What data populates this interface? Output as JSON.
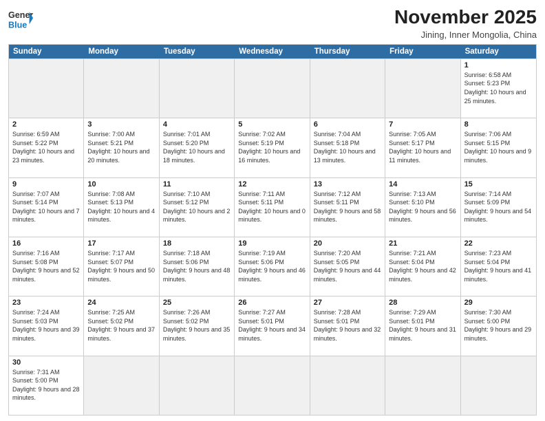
{
  "logo": {
    "text_general": "General",
    "text_blue": "Blue"
  },
  "title": "November 2025",
  "location": "Jining, Inner Mongolia, China",
  "header_days": [
    "Sunday",
    "Monday",
    "Tuesday",
    "Wednesday",
    "Thursday",
    "Friday",
    "Saturday"
  ],
  "rows": [
    [
      {
        "day": "",
        "info": "",
        "empty": true
      },
      {
        "day": "",
        "info": "",
        "empty": true
      },
      {
        "day": "",
        "info": "",
        "empty": true
      },
      {
        "day": "",
        "info": "",
        "empty": true
      },
      {
        "day": "",
        "info": "",
        "empty": true
      },
      {
        "day": "",
        "info": "",
        "empty": true
      },
      {
        "day": "1",
        "info": "Sunrise: 6:58 AM\nSunset: 5:23 PM\nDaylight: 10 hours\nand 25 minutes.",
        "empty": false
      }
    ],
    [
      {
        "day": "2",
        "info": "Sunrise: 6:59 AM\nSunset: 5:22 PM\nDaylight: 10 hours\nand 23 minutes.",
        "empty": false
      },
      {
        "day": "3",
        "info": "Sunrise: 7:00 AM\nSunset: 5:21 PM\nDaylight: 10 hours\nand 20 minutes.",
        "empty": false
      },
      {
        "day": "4",
        "info": "Sunrise: 7:01 AM\nSunset: 5:20 PM\nDaylight: 10 hours\nand 18 minutes.",
        "empty": false
      },
      {
        "day": "5",
        "info": "Sunrise: 7:02 AM\nSunset: 5:19 PM\nDaylight: 10 hours\nand 16 minutes.",
        "empty": false
      },
      {
        "day": "6",
        "info": "Sunrise: 7:04 AM\nSunset: 5:18 PM\nDaylight: 10 hours\nand 13 minutes.",
        "empty": false
      },
      {
        "day": "7",
        "info": "Sunrise: 7:05 AM\nSunset: 5:17 PM\nDaylight: 10 hours\nand 11 minutes.",
        "empty": false
      },
      {
        "day": "8",
        "info": "Sunrise: 7:06 AM\nSunset: 5:15 PM\nDaylight: 10 hours\nand 9 minutes.",
        "empty": false
      }
    ],
    [
      {
        "day": "9",
        "info": "Sunrise: 7:07 AM\nSunset: 5:14 PM\nDaylight: 10 hours\nand 7 minutes.",
        "empty": false
      },
      {
        "day": "10",
        "info": "Sunrise: 7:08 AM\nSunset: 5:13 PM\nDaylight: 10 hours\nand 4 minutes.",
        "empty": false
      },
      {
        "day": "11",
        "info": "Sunrise: 7:10 AM\nSunset: 5:12 PM\nDaylight: 10 hours\nand 2 minutes.",
        "empty": false
      },
      {
        "day": "12",
        "info": "Sunrise: 7:11 AM\nSunset: 5:11 PM\nDaylight: 10 hours\nand 0 minutes.",
        "empty": false
      },
      {
        "day": "13",
        "info": "Sunrise: 7:12 AM\nSunset: 5:11 PM\nDaylight: 9 hours\nand 58 minutes.",
        "empty": false
      },
      {
        "day": "14",
        "info": "Sunrise: 7:13 AM\nSunset: 5:10 PM\nDaylight: 9 hours\nand 56 minutes.",
        "empty": false
      },
      {
        "day": "15",
        "info": "Sunrise: 7:14 AM\nSunset: 5:09 PM\nDaylight: 9 hours\nand 54 minutes.",
        "empty": false
      }
    ],
    [
      {
        "day": "16",
        "info": "Sunrise: 7:16 AM\nSunset: 5:08 PM\nDaylight: 9 hours\nand 52 minutes.",
        "empty": false
      },
      {
        "day": "17",
        "info": "Sunrise: 7:17 AM\nSunset: 5:07 PM\nDaylight: 9 hours\nand 50 minutes.",
        "empty": false
      },
      {
        "day": "18",
        "info": "Sunrise: 7:18 AM\nSunset: 5:06 PM\nDaylight: 9 hours\nand 48 minutes.",
        "empty": false
      },
      {
        "day": "19",
        "info": "Sunrise: 7:19 AM\nSunset: 5:06 PM\nDaylight: 9 hours\nand 46 minutes.",
        "empty": false
      },
      {
        "day": "20",
        "info": "Sunrise: 7:20 AM\nSunset: 5:05 PM\nDaylight: 9 hours\nand 44 minutes.",
        "empty": false
      },
      {
        "day": "21",
        "info": "Sunrise: 7:21 AM\nSunset: 5:04 PM\nDaylight: 9 hours\nand 42 minutes.",
        "empty": false
      },
      {
        "day": "22",
        "info": "Sunrise: 7:23 AM\nSunset: 5:04 PM\nDaylight: 9 hours\nand 41 minutes.",
        "empty": false
      }
    ],
    [
      {
        "day": "23",
        "info": "Sunrise: 7:24 AM\nSunset: 5:03 PM\nDaylight: 9 hours\nand 39 minutes.",
        "empty": false
      },
      {
        "day": "24",
        "info": "Sunrise: 7:25 AM\nSunset: 5:02 PM\nDaylight: 9 hours\nand 37 minutes.",
        "empty": false
      },
      {
        "day": "25",
        "info": "Sunrise: 7:26 AM\nSunset: 5:02 PM\nDaylight: 9 hours\nand 35 minutes.",
        "empty": false
      },
      {
        "day": "26",
        "info": "Sunrise: 7:27 AM\nSunset: 5:01 PM\nDaylight: 9 hours\nand 34 minutes.",
        "empty": false
      },
      {
        "day": "27",
        "info": "Sunrise: 7:28 AM\nSunset: 5:01 PM\nDaylight: 9 hours\nand 32 minutes.",
        "empty": false
      },
      {
        "day": "28",
        "info": "Sunrise: 7:29 AM\nSunset: 5:01 PM\nDaylight: 9 hours\nand 31 minutes.",
        "empty": false
      },
      {
        "day": "29",
        "info": "Sunrise: 7:30 AM\nSunset: 5:00 PM\nDaylight: 9 hours\nand 29 minutes.",
        "empty": false
      }
    ],
    [
      {
        "day": "30",
        "info": "Sunrise: 7:31 AM\nSunset: 5:00 PM\nDaylight: 9 hours\nand 28 minutes.",
        "empty": false
      },
      {
        "day": "",
        "info": "",
        "empty": true
      },
      {
        "day": "",
        "info": "",
        "empty": true
      },
      {
        "day": "",
        "info": "",
        "empty": true
      },
      {
        "day": "",
        "info": "",
        "empty": true
      },
      {
        "day": "",
        "info": "",
        "empty": true
      },
      {
        "day": "",
        "info": "",
        "empty": true
      }
    ]
  ]
}
